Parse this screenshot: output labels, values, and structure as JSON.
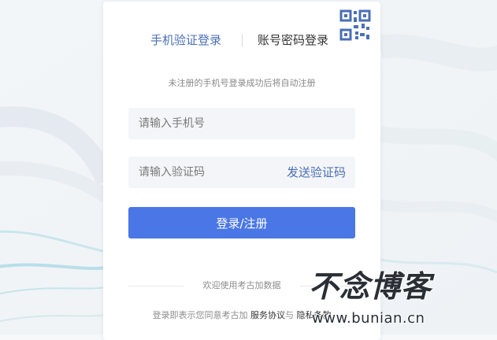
{
  "tabs": {
    "sms_login": "手机验证登录",
    "password_login": "账号密码登录"
  },
  "qr_icon": "qr-code-icon",
  "hint": "未注册的手机号登录成功后将自动注册",
  "form": {
    "phone_placeholder": "请输入手机号",
    "code_placeholder": "请输入验证码",
    "send_code": "发送验证码",
    "submit": "登录/注册"
  },
  "welcome": "欢迎使用考古加数据",
  "agreement": {
    "prefix": "登录即表示您同意考古加",
    "service": "服务协议",
    "and": "与",
    "privacy": "隐私条款"
  },
  "watermark": {
    "logo": "不念博客",
    "url": "www.bunian.cn"
  },
  "colors": {
    "accent": "#4a6fb5",
    "button": "#4a76e6",
    "background": "#f6f8fa"
  }
}
